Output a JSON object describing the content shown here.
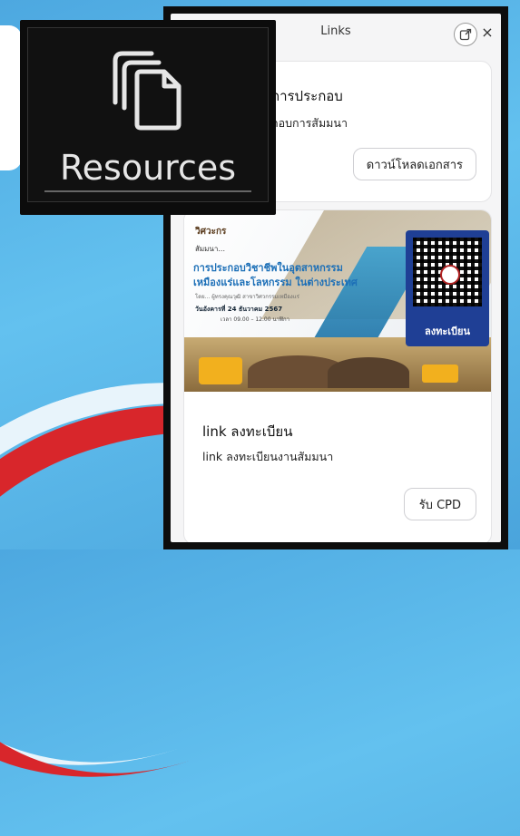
{
  "panel": {
    "title": "Links",
    "close_glyph": "×",
    "popout_icon": "external-link-icon"
  },
  "cards": [
    {
      "title": "การประกอบ",
      "subtitle": "กอบการสัมมนา",
      "button": "ดาวน์โหลดเอกสาร"
    },
    {
      "banner": {
        "brand": "วิศวะกร",
        "line_small": "สัมมนา...",
        "headline_1": "การประกอบวิชาชีพในอุตสาหกรรม",
        "headline_2": "เหมืองแร่และโลหกรรม ในต่างประเทศ",
        "tiny": "โดย... ผู้ทรงคุณวุฒิ สาขาวิศวกรรมเหมืองแร่",
        "date": "วันอังคารที่ 24 ธันวาคม 2567",
        "time": "เวลา 09.00 – 12.00 นาฬิกา",
        "qr_label": "ลงทะเบียน"
      },
      "title": "link ลงทะเบียน",
      "subtitle": "link ลงทะเบียนงานสัมมนา",
      "button": "รับ CPD"
    }
  ],
  "tooltip": {
    "label": "Resources",
    "icon": "copy-documents-icon"
  },
  "colors": {
    "background": "#5bb6e8",
    "panel_frame": "#0d0d0d",
    "qr_panel": "#1f3f95",
    "accent_red": "#d8262b"
  }
}
